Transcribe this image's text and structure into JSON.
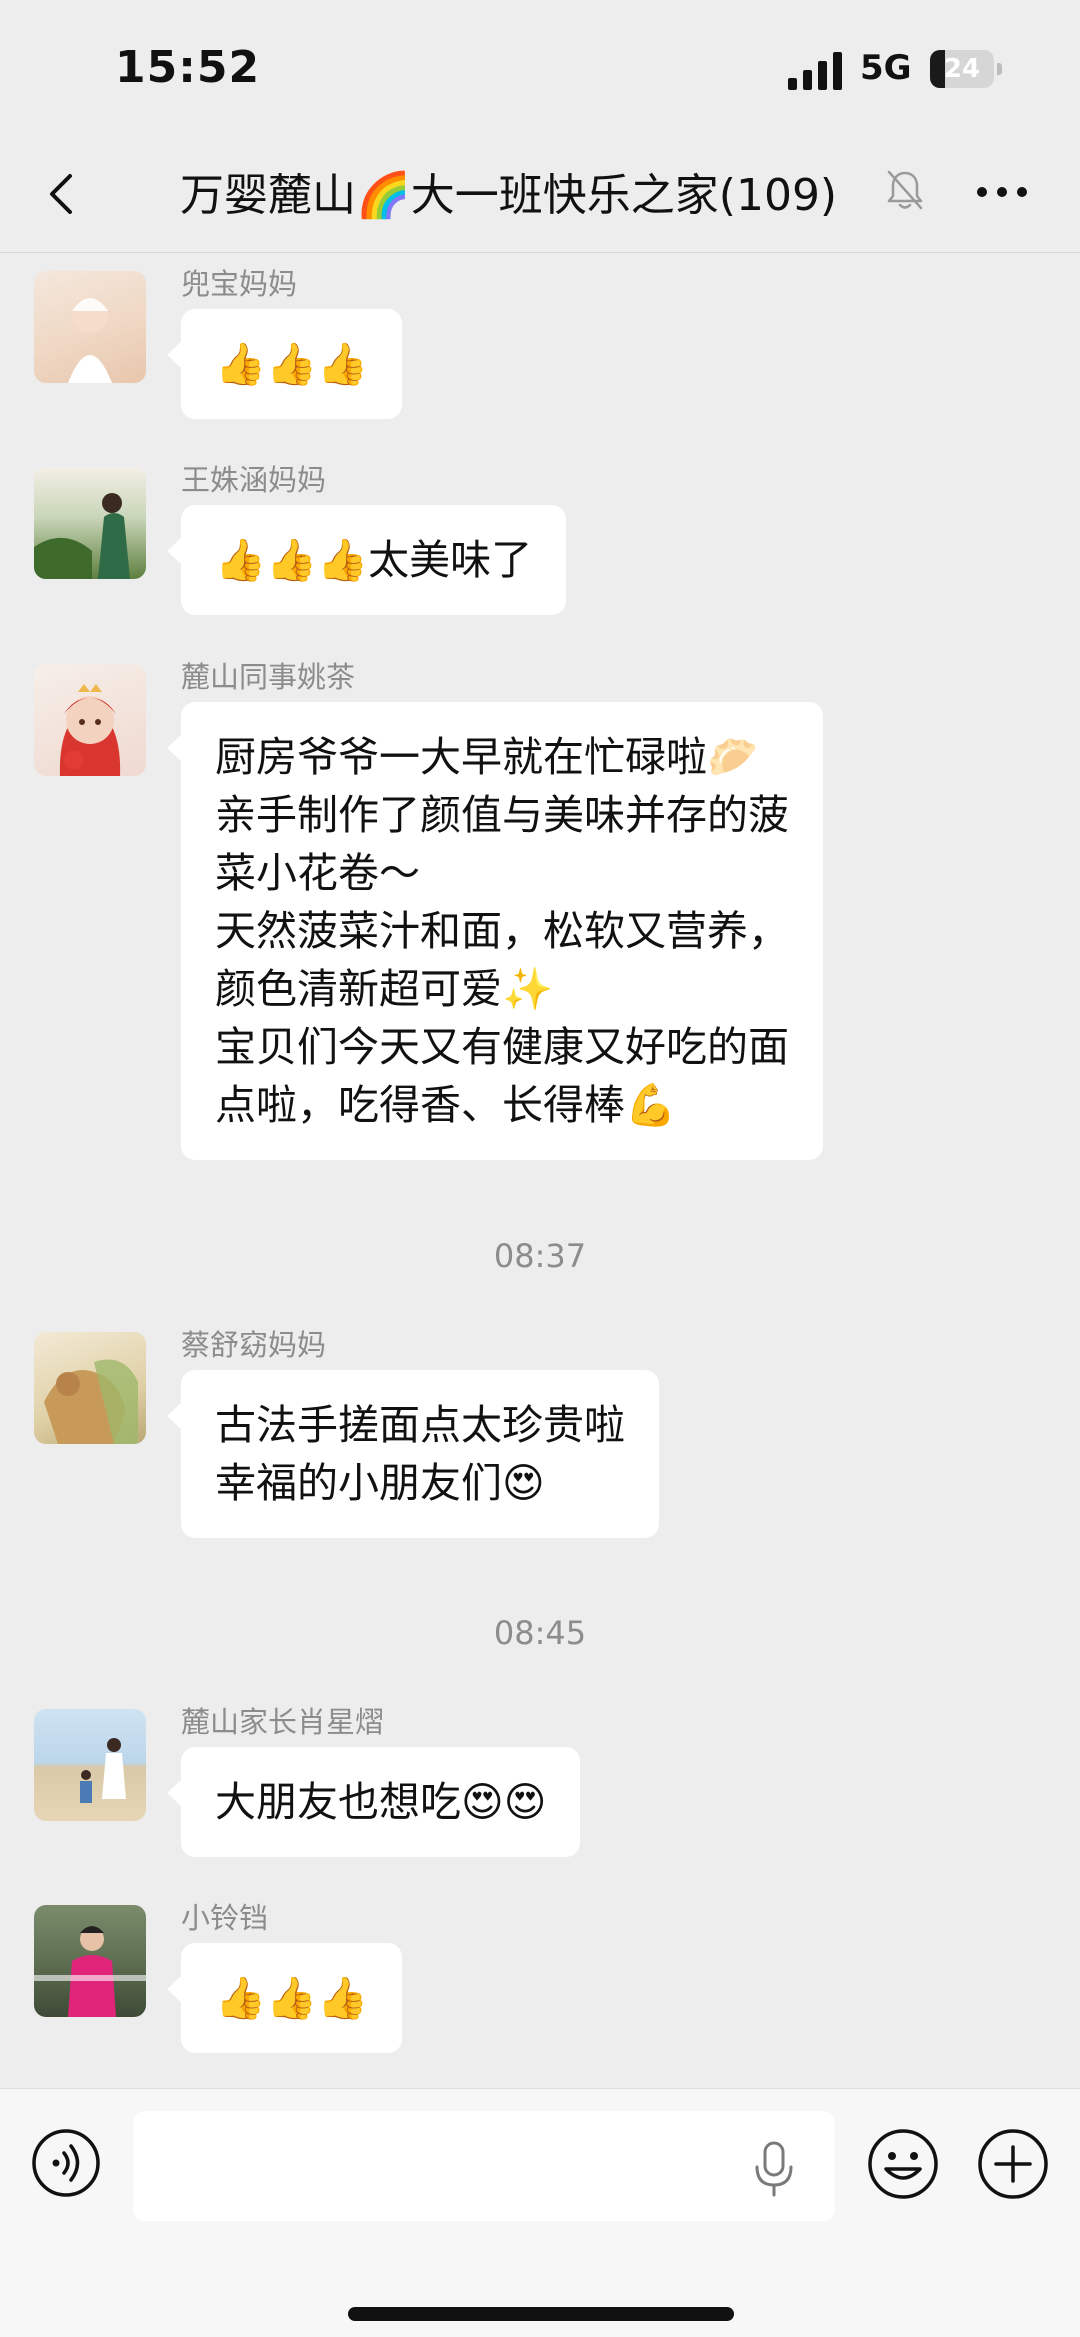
{
  "status_bar": {
    "time": "15:52",
    "network": "5G",
    "battery": "24",
    "battery_level": 0.24
  },
  "nav": {
    "title": "万婴麓山🌈大一班快乐之家(109)"
  },
  "messages": [
    {
      "sender": "兜宝妈妈",
      "lines": [
        "👍👍👍"
      ]
    },
    {
      "sender": "王姝涵妈妈",
      "lines": [
        "👍👍👍太美味了"
      ]
    },
    {
      "sender": "麓山同事姚茶",
      "lines": [
        "厨房爷爷一大早就在忙碌啦🥟",
        "亲手制作了颜值与美味并存的菠",
        "菜小花卷～",
        "天然菠菜汁和面，松软又营养，",
        "颜色清新超可爱✨",
        "宝贝们今天又有健康又好吃的面",
        "点啦，吃得香、长得棒💪"
      ]
    },
    {
      "sender": "蔡舒窈妈妈",
      "lines": [
        "古法手搓面点太珍贵啦",
        "幸福的小朋友们😍"
      ]
    },
    {
      "sender": "麓山家长肖星熠",
      "lines": [
        "大朋友也想吃😍😍"
      ]
    },
    {
      "sender": "小铃铛",
      "lines": [
        "👍👍👍"
      ]
    }
  ],
  "timestamps": [
    "08:37",
    "08:45"
  ],
  "input": {
    "value": "",
    "placeholder": ""
  },
  "icons": {
    "back": "chevron-left-icon",
    "mute": "bell-off-icon",
    "more": "more-dots-icon",
    "voice": "voice-wave-icon",
    "mic": "microphone-icon",
    "emoji": "smiley-icon",
    "plus": "plus-icon"
  },
  "colors": {
    "background": "#ededed",
    "bubble": "#ffffff",
    "meta_text": "#8c8c8c"
  }
}
